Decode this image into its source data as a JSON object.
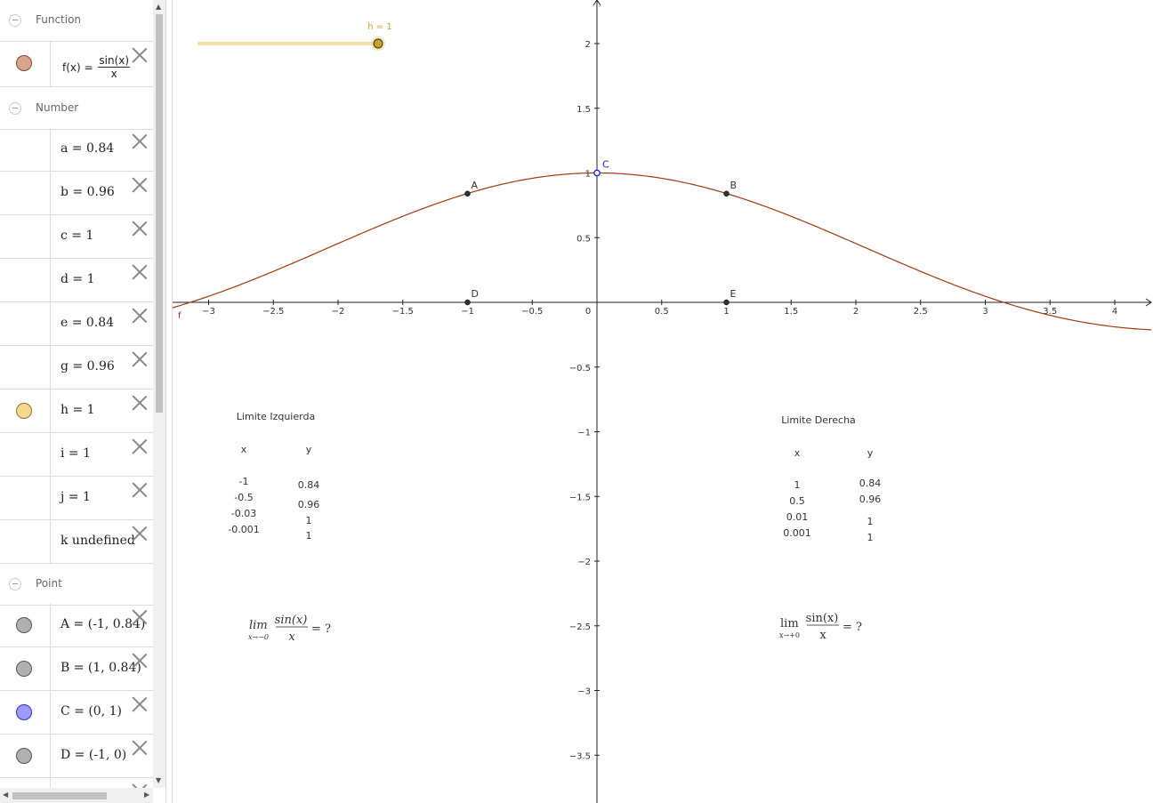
{
  "algebra": {
    "sections": [
      {
        "key": "function",
        "label": "Function"
      },
      {
        "key": "number",
        "label": "Number"
      },
      {
        "key": "point",
        "label": "Point"
      }
    ],
    "function_item": {
      "lhs": "f(x)",
      "numerator": "sin(x)",
      "denominator": "x",
      "color": "#d9a48f"
    },
    "number_items": [
      {
        "label": "a = 0.84"
      },
      {
        "label": "b = 0.96"
      },
      {
        "label": "c = 1"
      },
      {
        "label": "d = 1"
      },
      {
        "label": "e = 0.84"
      },
      {
        "label": "g = 0.96"
      },
      {
        "label": "h = 1",
        "marble": "#f3d98e"
      },
      {
        "label": "i = 1"
      },
      {
        "label": "j = 1"
      },
      {
        "label": "k undefined"
      }
    ],
    "point_items": [
      {
        "label": "A = (-1, 0.84)",
        "marble": "#b0b0b0"
      },
      {
        "label": "B = (1, 0.84)",
        "marble": "#b0b0b0"
      },
      {
        "label": "C = (0, 1)",
        "marble": "#9c9cff"
      },
      {
        "label": "D = (-1, 0)",
        "marble": "#b0b0b0"
      }
    ]
  },
  "graph": {
    "slider": {
      "label": "h = 1",
      "value": 1,
      "color": "#c9a227",
      "track_color": "#f0dfa0"
    },
    "curve": {
      "name": "f",
      "color": "#9b3b12"
    },
    "x_ticks": [
      "−3",
      "−2.5",
      "−2",
      "−1.5",
      "−1",
      "−0.5",
      "0",
      "0.5",
      "1",
      "1.5",
      "2",
      "2.5",
      "3",
      "3.5",
      "4"
    ],
    "y_ticks_pos": [
      "0.5",
      "1",
      "1.5",
      "2"
    ],
    "y_ticks_neg": [
      "−0.5",
      "−1",
      "−1.5",
      "−2",
      "−2.5",
      "−3",
      "−3.5"
    ],
    "points": [
      {
        "name": "A",
        "x": -1,
        "y": 0.84,
        "color": "#333333"
      },
      {
        "name": "B",
        "x": 1,
        "y": 0.84,
        "color": "#333333"
      },
      {
        "name": "C",
        "x": 0,
        "y": 1,
        "color": "#2222cc"
      },
      {
        "name": "D",
        "x": -1,
        "y": 0,
        "color": "#333333"
      },
      {
        "name": "E",
        "x": 1,
        "y": 0,
        "color": "#333333"
      }
    ],
    "left_table": {
      "title": "Limite Izquierda",
      "header_x": "x",
      "header_y": "y",
      "xs": [
        "-1",
        "-0.5",
        "-0.03",
        "-0.001"
      ],
      "ys": [
        "0.84",
        "0.96",
        "1",
        "1"
      ]
    },
    "right_table": {
      "title": "Limite Derecha",
      "header_x": "x",
      "header_y": "y",
      "xs": [
        "1",
        "0.5",
        "0.01",
        "0.001"
      ],
      "ys": [
        "0.84",
        "0.96",
        "1",
        "1"
      ]
    },
    "left_limit": {
      "lim": "lim",
      "sub": "x→−0",
      "num": "sin(x)",
      "den": "x",
      "rhs": "= ?"
    },
    "right_limit": {
      "lim": "lim",
      "sub": "x→+0",
      "num": "sin(x)",
      "den": "x",
      "rhs": "= ?"
    }
  }
}
